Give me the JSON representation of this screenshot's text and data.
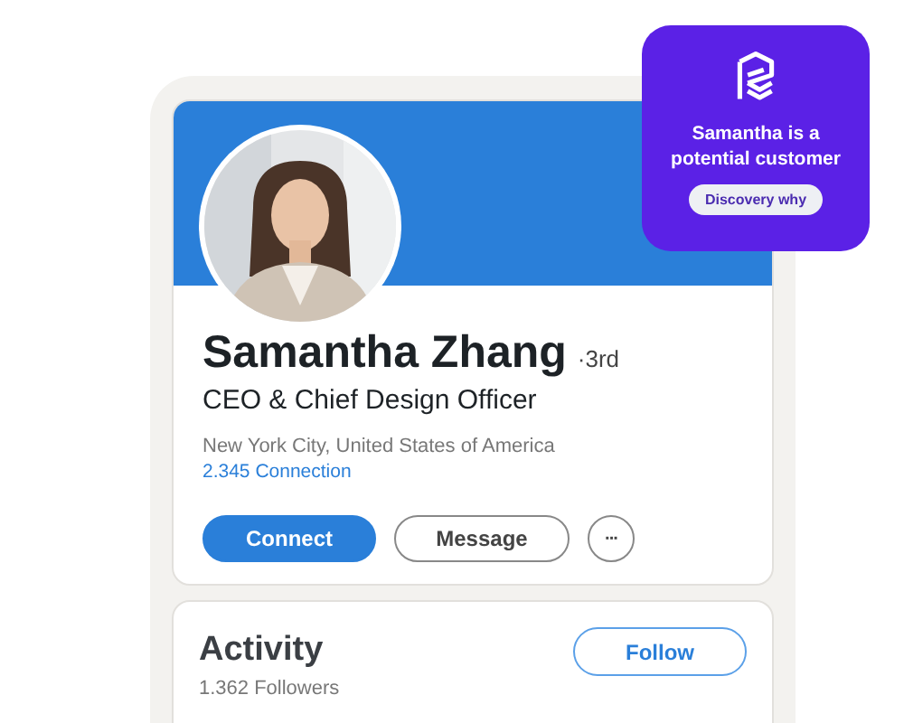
{
  "profile": {
    "name": "Samantha Zhang",
    "degree": "·3rd",
    "headline": "CEO & Chief Design Officer",
    "location": "New York City, United States of America",
    "connections": "2.345 Connection",
    "buttons": [
      {
        "kind": "primary",
        "label": "Connect"
      },
      {
        "kind": "outline",
        "label": "Message"
      },
      {
        "kind": "more",
        "label": "···"
      }
    ]
  },
  "activity": {
    "title": "Activity",
    "followers": "1.362 Followers",
    "follow_button": "Follow"
  },
  "popup": {
    "message": "Samantha is a potential customer",
    "button": "Discovery why"
  }
}
